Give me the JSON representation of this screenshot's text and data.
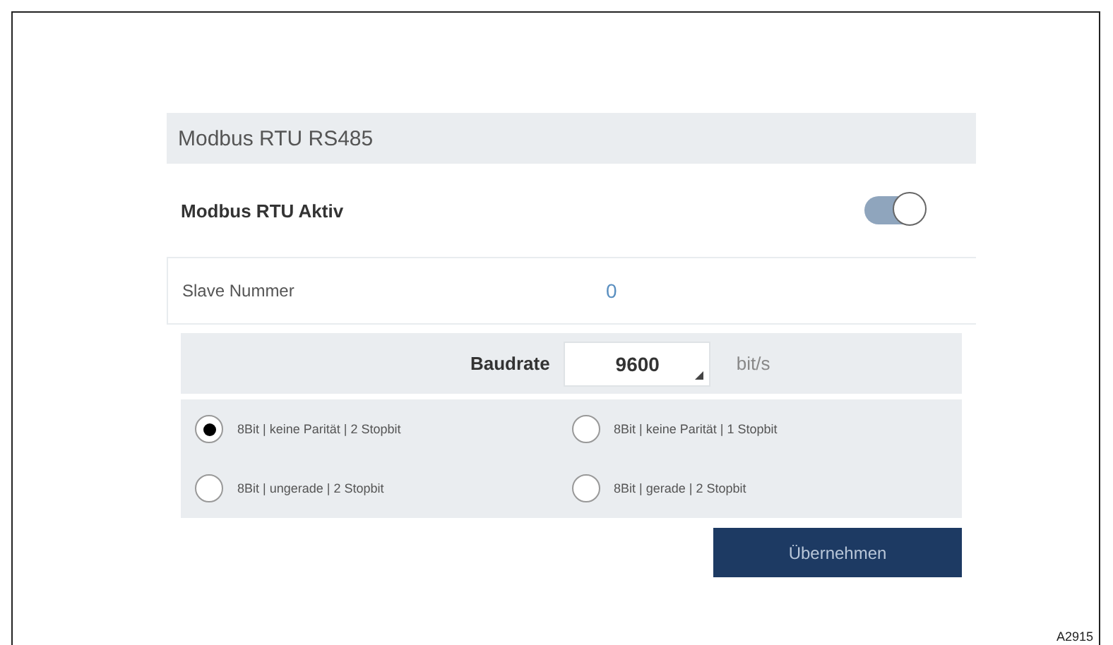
{
  "panel": {
    "title": "Modbus RTU RS485"
  },
  "active": {
    "label": "Modbus RTU Aktiv",
    "on": true
  },
  "slave": {
    "label": "Slave Nummer",
    "value": "0"
  },
  "baudrate": {
    "label": "Baudrate",
    "value": "9600",
    "unit": "bit/s"
  },
  "options": [
    {
      "label": "8Bit | keine Parität | 2 Stopbit",
      "selected": true
    },
    {
      "label": "8Bit | keine Parität | 1 Stopbit",
      "selected": false
    },
    {
      "label": "8Bit | ungerade | 2 Stopbit",
      "selected": false
    },
    {
      "label": "8Bit | gerade | 2 Stopbit",
      "selected": false
    }
  ],
  "apply_button": "Übernehmen",
  "figure_code": "A2915"
}
